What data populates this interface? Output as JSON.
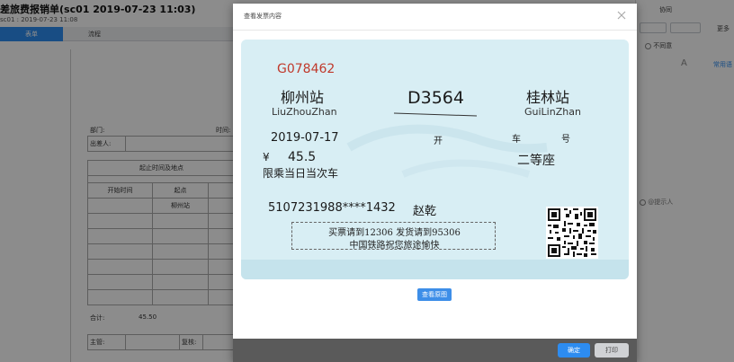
{
  "app": {
    "title": "差旅费报销单(sc01 2019-07-23 11:03)",
    "subtitle": "sc01 : 2019-07-23 11:08",
    "tabs": [
      {
        "label": "表单"
      },
      {
        "label": "流程"
      }
    ],
    "form": {
      "dept_label": "部门:",
      "time_label": "时间:",
      "traveler_label": "出差人:",
      "section_label": "起止时间及地点",
      "col_start_time": "开始时间",
      "col_origin": "起点",
      "row1_origin": "柳州站",
      "total_label": "合计:",
      "total_value": "45.50",
      "supervisor_label": "主管:",
      "review_label": "复核:"
    },
    "right_panel": {
      "collab_label": "协同",
      "more_label": "更多",
      "disagree_label": "不同意",
      "font_icon_glyph": "A",
      "common_label": "常用语",
      "notify_label": "@提示人"
    }
  },
  "modal": {
    "title": "查看发票内容",
    "view_original_label": "查看原图",
    "ok_label": "确定",
    "print_label": "打印"
  },
  "ticket": {
    "code": "G078462",
    "from_station": "柳州站",
    "from_station_en": "LiuZhouZhan",
    "train_no": "D3564",
    "to_station": "桂林站",
    "to_station_en": "GuiLinZhan",
    "date": "2019-07-17",
    "depart_char": "开",
    "car_char": "车",
    "seat_char": "号",
    "currency_symbol": "¥",
    "price": "45.5",
    "seat_class": "二等座",
    "limit_text": "限乘当日当次车",
    "passenger_id": "5107231988****1432",
    "passenger_name": "赵乾",
    "notice_line1": "买票请到12306 发货请到95306",
    "notice_line2": "中国铁路祝您旅途愉快"
  },
  "colors": {
    "primary": "#2d8cf0",
    "ticket_bg": "#d8eef4",
    "ticket_code": "#c0392b"
  }
}
